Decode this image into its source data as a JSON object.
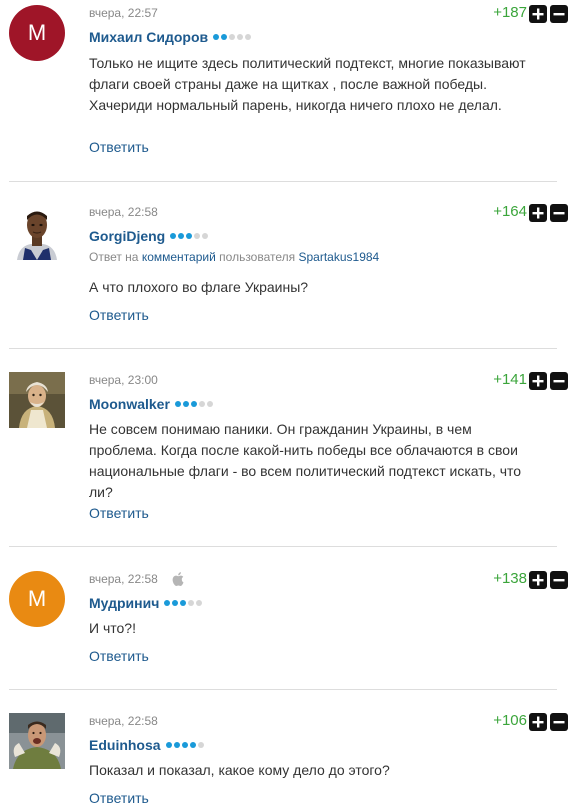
{
  "colors": {
    "author": "#1e5a8e",
    "score": "#3ba53b",
    "rating_on": "#1a9ad9",
    "rating_off": "#d6d6d6",
    "avatar_red": "#9f1528",
    "avatar_orange": "#e98a12"
  },
  "comments": [
    {
      "avatar": {
        "type": "letter",
        "letter": "М",
        "color": "#9f1528"
      },
      "time": "вчера, 22:57",
      "author": "Михаил Сидоров",
      "rating_level": 2,
      "rating_max": 5,
      "score": "+187",
      "text": "Только не ищите здесь политический подтекст, многие показывают флаги своей страны даже на щитках , после важной победы. Хачериди нормальный парень, никогда ничего плохо не делал.",
      "reply_label": "Ответить"
    },
    {
      "avatar": {
        "type": "photo",
        "icon": "player-photo-avatar"
      },
      "time": "вчера, 22:58",
      "author": "GorgiDjeng",
      "rating_level": 3,
      "rating_max": 5,
      "score": "+164",
      "reply_to": {
        "prefix": "Ответ на",
        "link": "комментарий",
        "middle": "пользователя",
        "user": "Spartakus1984"
      },
      "text": "А что плохого во флаге Украины?",
      "reply_label": "Ответить"
    },
    {
      "avatar": {
        "type": "photo",
        "icon": "old-man-photo-avatar"
      },
      "time": "вчера, 23:00",
      "author": "Moonwalker",
      "rating_level": 3,
      "rating_max": 5,
      "score": "+141",
      "text": "Не совсем понимаю паники. Он гражданин Украины, в чем проблема. Когда после какой-нить победы все облачаются в свои национальные флаги - во всем политический подтекст искать, что ли?",
      "reply_label": "Ответить"
    },
    {
      "avatar": {
        "type": "letter",
        "letter": "М",
        "color": "#e98a12"
      },
      "time": "вчера, 22:58",
      "device_icon": "apple-icon",
      "author": "Мудринич",
      "rating_level": 3,
      "rating_max": 5,
      "score": "+138",
      "text": "И что?!",
      "reply_label": "Ответить"
    },
    {
      "avatar": {
        "type": "photo",
        "icon": "goalkeeper-photo-avatar"
      },
      "time": "вчера, 22:58",
      "author": "Eduinhosa",
      "rating_level": 4,
      "rating_max": 5,
      "score": "+106",
      "text": "Показал и показал, какое кому дело до этого?",
      "reply_label": "Ответить"
    }
  ]
}
